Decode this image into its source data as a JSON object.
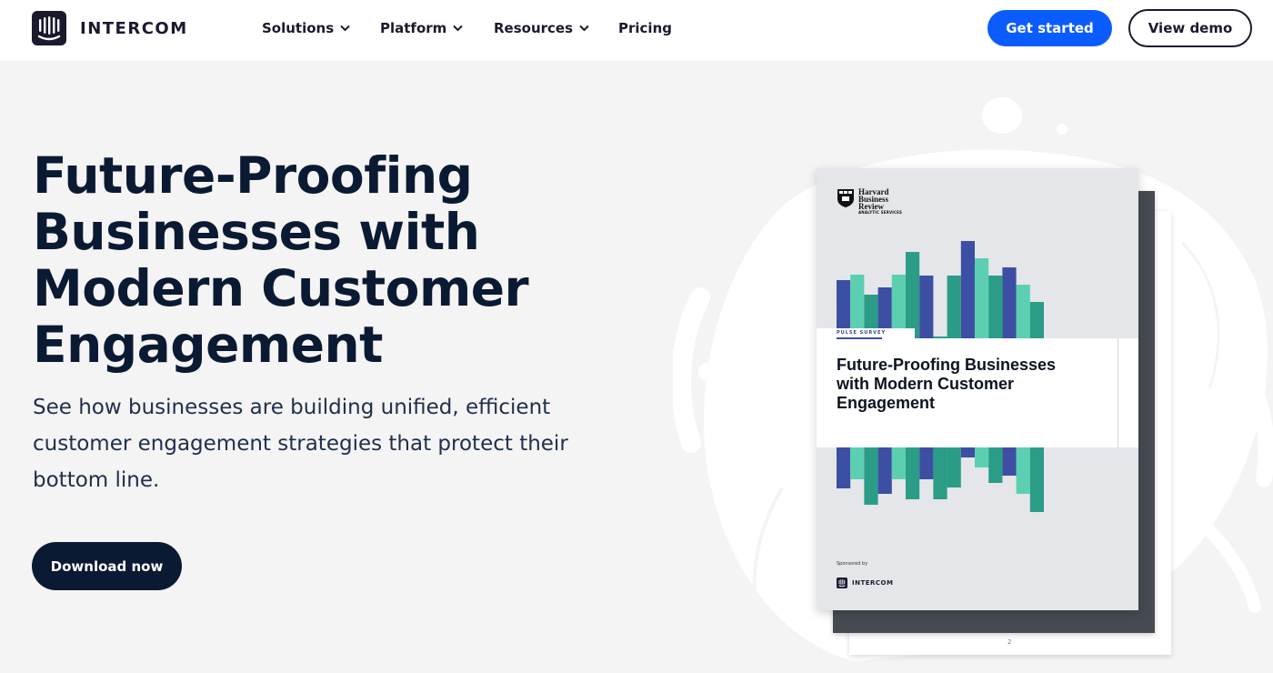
{
  "brand": {
    "name": "INTERCOM",
    "accent": "#0b5cff",
    "dark": "#0b1a33"
  },
  "nav": {
    "items": [
      {
        "label": "Solutions",
        "has_dropdown": true,
        "icon": "chevron-down-icon"
      },
      {
        "label": "Platform",
        "has_dropdown": true,
        "icon": "chevron-down-icon"
      },
      {
        "label": "Resources",
        "has_dropdown": true,
        "icon": "chevron-down-icon"
      },
      {
        "label": "Pricing",
        "has_dropdown": false
      }
    ],
    "get_started": "Get started",
    "view_demo": "View demo"
  },
  "hero": {
    "title_lines": [
      "Future-Proofing",
      "Businesses with",
      "Modern Customer",
      "Engagement"
    ],
    "subtitle": "See how businesses are building unified, efficient customer engagement strategies that protect their bottom line.",
    "cta": "Download now"
  },
  "report": {
    "publisher_lines": [
      "Harvard",
      "Business",
      "Review"
    ],
    "publisher_sub": "ANALYTIC SERVICES",
    "label": "PULSE SURVEY",
    "title_lines": [
      "Future-Proofing Businesses",
      "with Modern Customer",
      "Engagement"
    ],
    "sponsored": "Sponsored by",
    "sponsor": "INTERCOM",
    "page_number": "2",
    "colors": {
      "blue": "#3d4fa3",
      "teal": "#2b9c86",
      "mint": "#5ccfb2"
    }
  }
}
